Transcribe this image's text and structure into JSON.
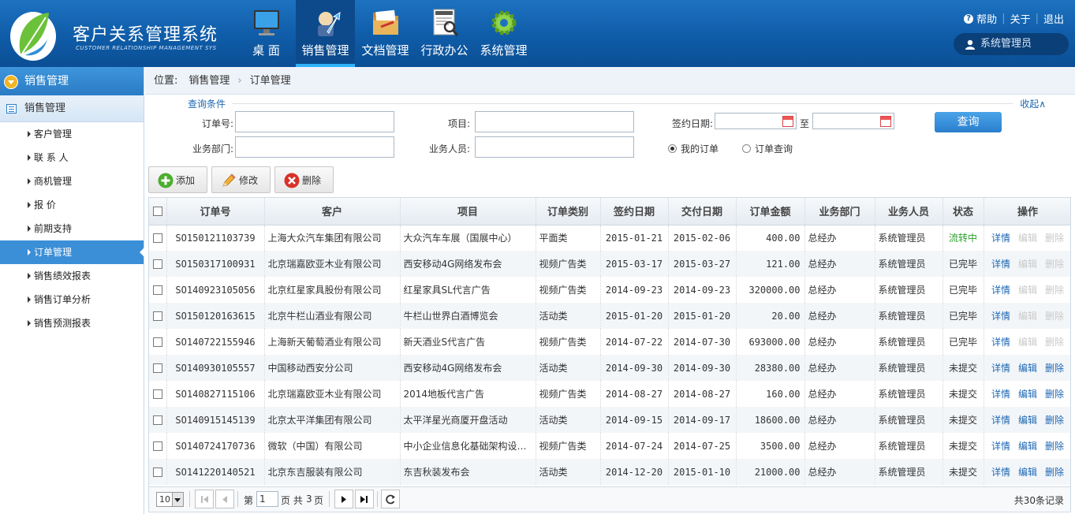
{
  "header": {
    "brand_cn": "客户关系管理系统",
    "brand_en": "CUSTOMER RELATIONSHIP MANAGEMENT SYS",
    "nav": [
      {
        "label": "桌 面",
        "icon": "monitor-icon"
      },
      {
        "label": "销售管理",
        "icon": "sales-chart-icon"
      },
      {
        "label": "文档管理",
        "icon": "folder-icon"
      },
      {
        "label": "行政办公",
        "icon": "news-icon"
      },
      {
        "label": "系统管理",
        "icon": "gear-icon"
      }
    ],
    "active_nav": 1,
    "help": "帮助",
    "about": "关于",
    "logout": "退出",
    "user": "系统管理员"
  },
  "sidebar": {
    "header": "销售管理",
    "group": "销售管理",
    "items": [
      {
        "label": "客户管理"
      },
      {
        "label": "联 系 人"
      },
      {
        "label": "商机管理"
      },
      {
        "label": "报  价"
      },
      {
        "label": "前期支持"
      },
      {
        "label": "订单管理"
      },
      {
        "label": "销售绩效报表"
      },
      {
        "label": "销售订单分析"
      },
      {
        "label": "销售预测报表"
      }
    ],
    "active_index": 5
  },
  "breadcrumb": {
    "prefix": "位置:",
    "items": [
      "销售管理",
      "订单管理"
    ]
  },
  "search": {
    "legend": "查询条件",
    "collapse": "收起∧",
    "order_no_label": "订单号:",
    "order_no_value": "",
    "project_label": "项目:",
    "project_value": "",
    "sign_date_label": "签约日期:",
    "date_from": "",
    "date_to_sep": "至",
    "date_to": "",
    "dept_label": "业务部门:",
    "dept_value": "",
    "staff_label": "业务人员:",
    "staff_value": "",
    "radio_my": "我的订单",
    "radio_query": "订单查询",
    "radio_selected": "我的订单",
    "query_button": "查询"
  },
  "toolbar": {
    "add": "添加",
    "edit": "修改",
    "delete": "删除"
  },
  "table": {
    "columns": [
      "订单号",
      "客户",
      "项目",
      "订单类别",
      "签约日期",
      "交付日期",
      "订单金额",
      "业务部门",
      "业务人员",
      "状态",
      "操作"
    ],
    "actions": [
      "详情",
      "编辑",
      "删除"
    ],
    "rows": [
      {
        "order_no": "SO150121103739",
        "customer": "上海大众汽车集团有限公司",
        "project": "大众汽车车展（国展中心）",
        "category": "平面类",
        "sign_date": "2015-01-21",
        "delivery_date": "2015-02-06",
        "amount": "400.00",
        "dept": "总经办",
        "staff": "系统管理员",
        "status": "流转中",
        "editable": false
      },
      {
        "order_no": "SO150317100931",
        "customer": "北京瑞嘉欧亚木业有限公司",
        "project": "西安移动4G网络发布会",
        "category": "视频广告类",
        "sign_date": "2015-03-17",
        "delivery_date": "2015-03-27",
        "amount": "121.00",
        "dept": "总经办",
        "staff": "系统管理员",
        "status": "已完毕",
        "editable": false
      },
      {
        "order_no": "SO140923105056",
        "customer": "北京红星家具股份有限公司",
        "project": "红星家具SL代言广告",
        "category": "视频广告类",
        "sign_date": "2014-09-23",
        "delivery_date": "2014-09-23",
        "amount": "320000.00",
        "dept": "总经办",
        "staff": "系统管理员",
        "status": "已完毕",
        "editable": false
      },
      {
        "order_no": "SO150120163615",
        "customer": "北京牛栏山酒业有限公司",
        "project": "牛栏山世界白酒博览会",
        "category": "活动类",
        "sign_date": "2015-01-20",
        "delivery_date": "2015-01-20",
        "amount": "20.00",
        "dept": "总经办",
        "staff": "系统管理员",
        "status": "已完毕",
        "editable": false
      },
      {
        "order_no": "SO140722155946",
        "customer": "上海新天葡萄酒业有限公司",
        "project": "新天酒业S代言广告",
        "category": "视频广告类",
        "sign_date": "2014-07-22",
        "delivery_date": "2014-07-30",
        "amount": "693000.00",
        "dept": "总经办",
        "staff": "系统管理员",
        "status": "已完毕",
        "editable": false
      },
      {
        "order_no": "SO140930105557",
        "customer": "中国移动西安分公司",
        "project": "西安移动4G网络发布会",
        "category": "活动类",
        "sign_date": "2014-09-30",
        "delivery_date": "2014-09-30",
        "amount": "28380.00",
        "dept": "总经办",
        "staff": "系统管理员",
        "status": "未提交",
        "editable": true
      },
      {
        "order_no": "SO140827115106",
        "customer": "北京瑞嘉欧亚木业有限公司",
        "project": "2014地板代言广告",
        "category": "视频广告类",
        "sign_date": "2014-08-27",
        "delivery_date": "2014-08-27",
        "amount": "160.00",
        "dept": "总经办",
        "staff": "系统管理员",
        "status": "未提交",
        "editable": true
      },
      {
        "order_no": "SO140915145139",
        "customer": "北京太平洋集团有限公司",
        "project": "太平洋星光商厦开盘活动",
        "category": "活动类",
        "sign_date": "2014-09-15",
        "delivery_date": "2014-09-17",
        "amount": "18600.00",
        "dept": "总经办",
        "staff": "系统管理员",
        "status": "未提交",
        "editable": true
      },
      {
        "order_no": "SO140724170736",
        "customer": "微软（中国）有限公司",
        "project": "中小企业信息化基础架构设计...",
        "category": "视频广告类",
        "sign_date": "2014-07-24",
        "delivery_date": "2014-07-25",
        "amount": "3500.00",
        "dept": "总经办",
        "staff": "系统管理员",
        "status": "未提交",
        "editable": true
      },
      {
        "order_no": "SO141220140521",
        "customer": "北京东吉服装有限公司",
        "project": "东吉秋装发布会",
        "category": "活动类",
        "sign_date": "2014-12-20",
        "delivery_date": "2015-01-10",
        "amount": "21000.00",
        "dept": "总经办",
        "staff": "系统管理员",
        "status": "未提交",
        "editable": true
      }
    ]
  },
  "pager": {
    "page_size": "10",
    "page_prefix": "第",
    "current_page": "1",
    "page_mid": "页 共",
    "total_pages": "3",
    "page_suffix": "页",
    "total_records": "共30条记录"
  },
  "colors": {
    "header_blue": "#0f5ca8",
    "accent_blue": "#3b8fd7",
    "status_flow": "#2ca02c",
    "link_blue": "#1d67b3",
    "disabled": "#c9c9c9"
  }
}
